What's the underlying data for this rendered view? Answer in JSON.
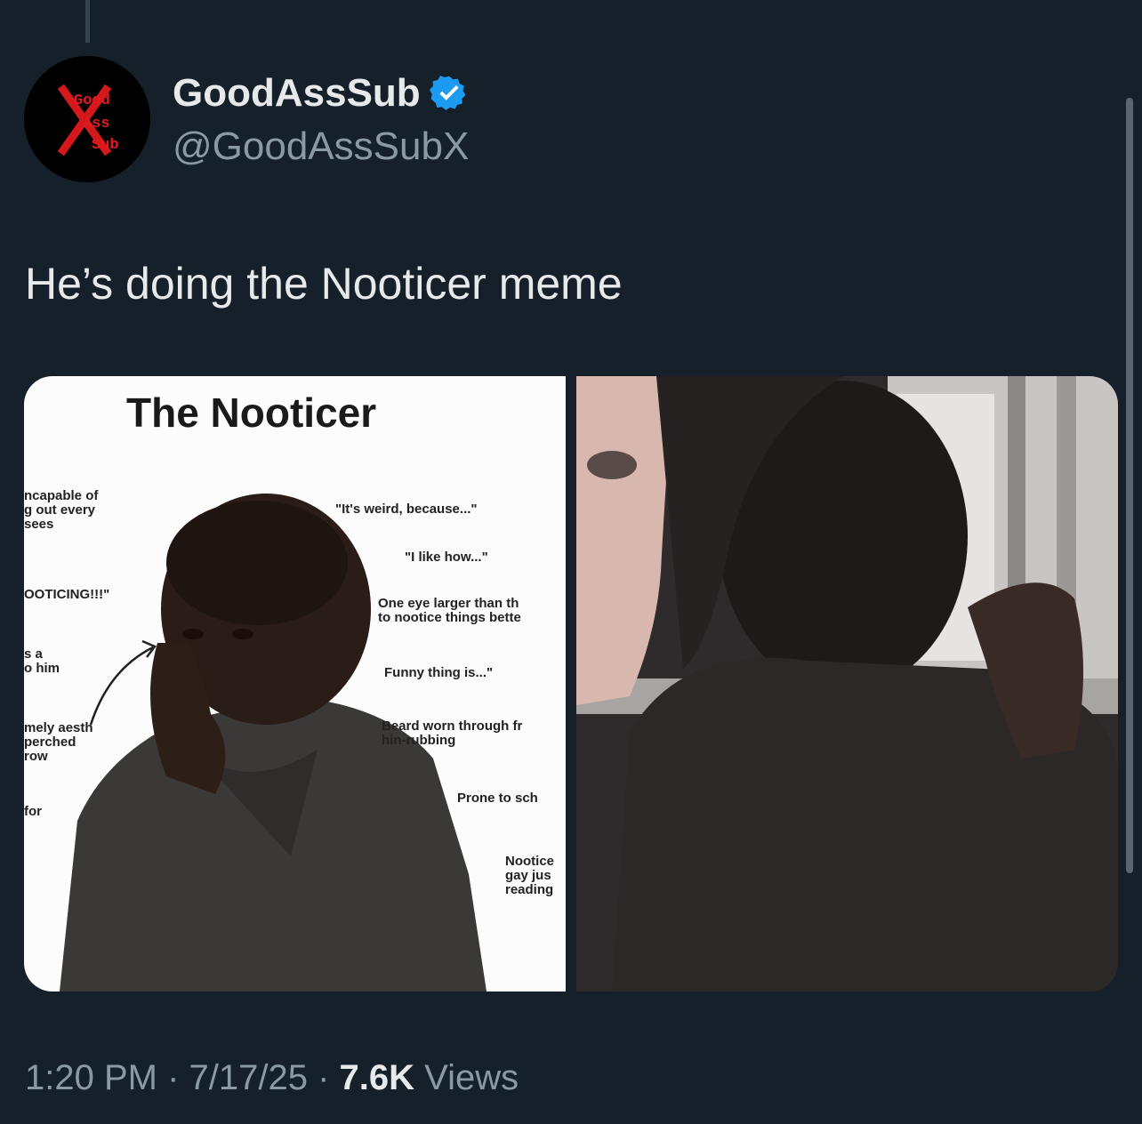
{
  "author": {
    "display_name": "GoodAssSub",
    "handle": "@GoodAssSubX",
    "verified_icon": "verified-badge-icon",
    "avatar_logo_text": [
      "Good",
      "Ass",
      "Sub"
    ]
  },
  "tweet": {
    "text": "He’s doing the Nooticer meme"
  },
  "media": {
    "left_image": {
      "title": "The Nooticer",
      "labels": [
        "ncapable of\ng out every\nsees",
        "OOTICING!!!\"",
        "s a\no him",
        "mely aesth\nperched\nrow",
        "for",
        "\"It's weird, because...\"",
        "\"I like how...\"",
        "One eye larger than th\nto nootice things bette",
        "Funny thing is...\"",
        "Beard worn through fr\nhin-rubbing",
        "Prone to sch",
        "Nootice\ngay jus\nreading"
      ]
    },
    "right_image": {}
  },
  "meta": {
    "time": "1:20 PM",
    "sep1": " · ",
    "date": "7/17/25",
    "sep2": " · ",
    "views_count": "7.6K",
    "views_label": " Views"
  },
  "colors": {
    "background": "#15202b",
    "primary_text": "#e7e9ea",
    "secondary_text": "#8b98a5",
    "verified": "#1d9bf0",
    "logo_red": "#d4181c"
  }
}
